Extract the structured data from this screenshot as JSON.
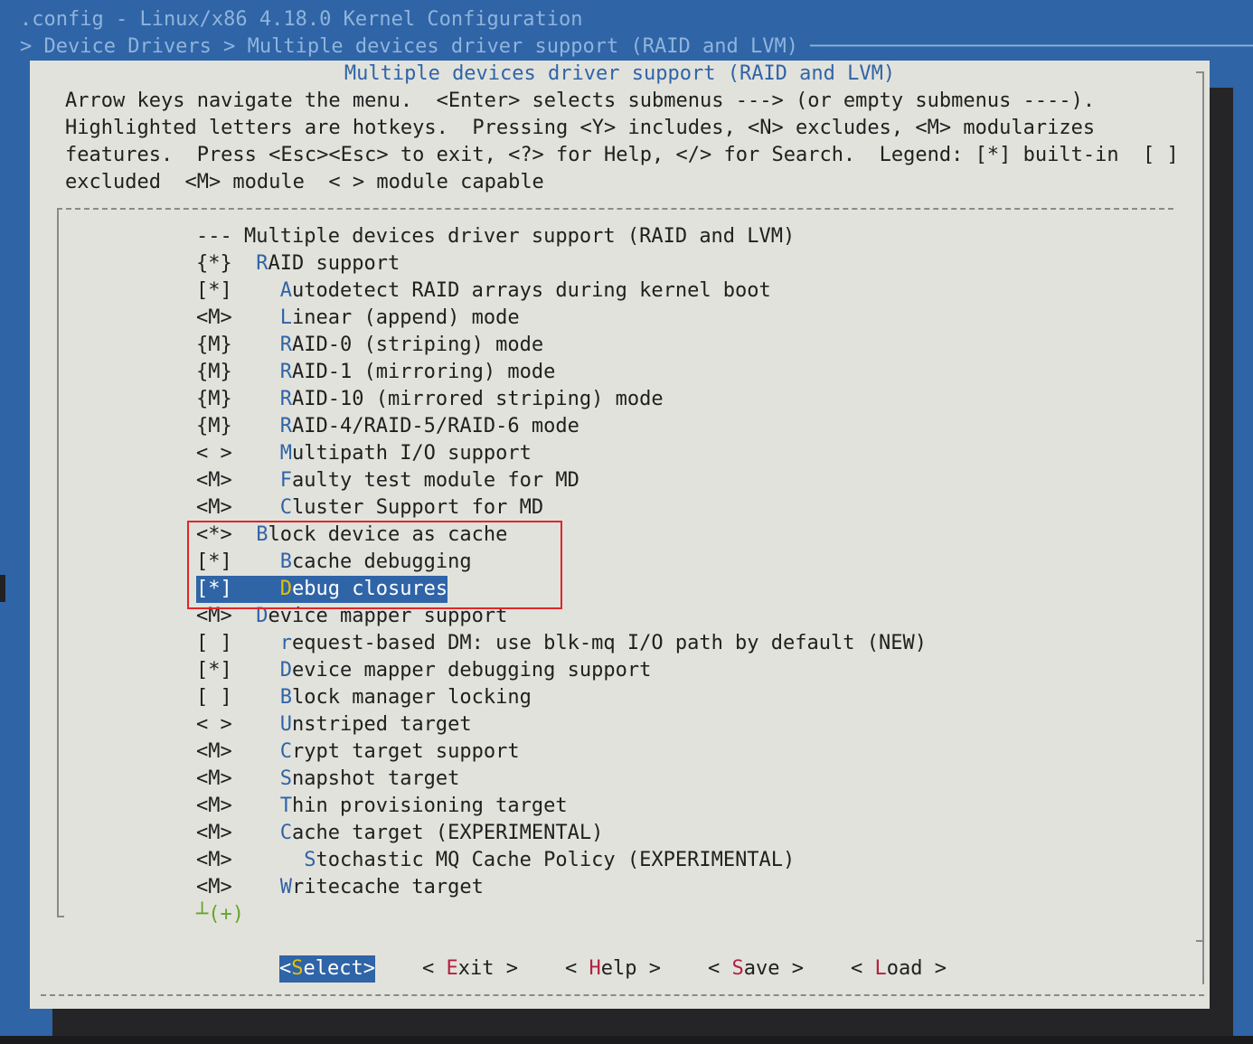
{
  "header": {
    "title": ".config - Linux/x86 4.18.0 Kernel Configuration",
    "breadcrumb": "> Device Drivers > Multiple devices driver support (RAID and LVM) ─────────────────────────────────────────"
  },
  "dialog": {
    "title": "Multiple devices driver support (RAID and LVM)",
    "help_lines": [
      "Arrow keys navigate the menu.  <Enter> selects submenus ---> (or empty submenus ----).",
      "Highlighted letters are hotkeys.  Pressing <Y> includes, <N> excludes, <M> modularizes",
      "features.  Press <Esc><Esc> to exit, <?> for Help, </> for Search.  Legend: [*] built-in  [ ]",
      "excluded  <M> module  < > module capable"
    ]
  },
  "menu": {
    "items": [
      {
        "state": "---",
        "indent": " ",
        "hotkey": "",
        "label": "Multiple devices driver support (RAID and LVM)"
      },
      {
        "state": "{*}",
        "indent": "  ",
        "hotkey": "R",
        "label": "AID support"
      },
      {
        "state": "[*]",
        "indent": "    ",
        "hotkey": "A",
        "label": "utodetect RAID arrays during kernel boot"
      },
      {
        "state": "<M>",
        "indent": "    ",
        "hotkey": "L",
        "label": "inear (append) mode"
      },
      {
        "state": "{M}",
        "indent": "    ",
        "hotkey": "R",
        "label": "AID-0 (striping) mode"
      },
      {
        "state": "{M}",
        "indent": "    ",
        "hotkey": "R",
        "label": "AID-1 (mirroring) mode"
      },
      {
        "state": "{M}",
        "indent": "    ",
        "hotkey": "R",
        "label": "AID-10 (mirrored striping) mode"
      },
      {
        "state": "{M}",
        "indent": "    ",
        "hotkey": "R",
        "label": "AID-4/RAID-5/RAID-6 mode"
      },
      {
        "state": "< >",
        "indent": "    ",
        "hotkey": "M",
        "label": "ultipath I/O support"
      },
      {
        "state": "<M>",
        "indent": "    ",
        "hotkey": "F",
        "label": "aulty test module for MD"
      },
      {
        "state": "<M>",
        "indent": "    ",
        "hotkey": "C",
        "label": "luster Support for MD"
      },
      {
        "state": "<*>",
        "indent": "  ",
        "hotkey": "B",
        "label": "lock device as cache"
      },
      {
        "state": "[*]",
        "indent": "    ",
        "hotkey": "B",
        "label": "cache debugging"
      },
      {
        "state": "[*]",
        "indent": "    ",
        "hotkey": "D",
        "label": "ebug closures"
      },
      {
        "state": "<M>",
        "indent": "  ",
        "hotkey": "D",
        "label": "evice mapper support"
      },
      {
        "state": "[ ]",
        "indent": "    ",
        "hotkey": "r",
        "label": "equest-based DM: use blk-mq I/O path by default (NEW)"
      },
      {
        "state": "[*]",
        "indent": "    ",
        "hotkey": "D",
        "label": "evice mapper debugging support"
      },
      {
        "state": "[ ]",
        "indent": "    ",
        "hotkey": "B",
        "label": "lock manager locking"
      },
      {
        "state": "< >",
        "indent": "    ",
        "hotkey": "U",
        "label": "nstriped target"
      },
      {
        "state": "<M>",
        "indent": "    ",
        "hotkey": "C",
        "label": "rypt target support"
      },
      {
        "state": "<M>",
        "indent": "    ",
        "hotkey": "S",
        "label": "napshot target"
      },
      {
        "state": "<M>",
        "indent": "    ",
        "hotkey": "T",
        "label": "hin provisioning target"
      },
      {
        "state": "<M>",
        "indent": "    ",
        "hotkey": "C",
        "label": "ache target (EXPERIMENTAL)"
      },
      {
        "state": "<M>",
        "indent": "      ",
        "hotkey": "S",
        "label": "tochastic MQ Cache Policy (EXPERIMENTAL)"
      },
      {
        "state": "<M>",
        "indent": "    ",
        "hotkey": "W",
        "label": "ritecache target"
      }
    ],
    "selected_index": 13,
    "more_indicator": "┴(+)"
  },
  "buttons": [
    {
      "pre": "<",
      "hotkey": "S",
      "post": "elect>"
    },
    {
      "pre": "< ",
      "hotkey": "E",
      "post": "xit >"
    },
    {
      "pre": "< ",
      "hotkey": "H",
      "post": "elp >"
    },
    {
      "pre": "< ",
      "hotkey": "S",
      "post": "ave >"
    },
    {
      "pre": "< ",
      "hotkey": "L",
      "post": "oad >"
    }
  ],
  "colors": {
    "background": "#2f64a7",
    "dialog": "#e2e2dc",
    "hotkey": "#2f64a7",
    "button_hotkey": "#b22040",
    "selected_hotkey": "#e5c000",
    "annotation_frame": "#e0262a"
  }
}
